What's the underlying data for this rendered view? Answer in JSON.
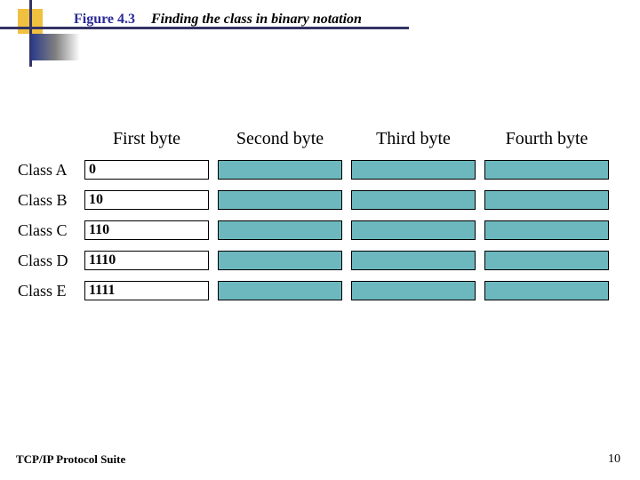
{
  "header": {
    "figure_label": "Figure 4.3",
    "figure_title": "Finding the class in binary notation"
  },
  "column_headers": [
    "First byte",
    "Second byte",
    "Third byte",
    "Fourth byte"
  ],
  "rows": [
    {
      "label": "Class A",
      "prefix": "0"
    },
    {
      "label": "Class B",
      "prefix": "10"
    },
    {
      "label": "Class C",
      "prefix": "110"
    },
    {
      "label": "Class D",
      "prefix": "1110"
    },
    {
      "label": "Class E",
      "prefix": "1111"
    }
  ],
  "footer": {
    "left": "TCP/IP Protocol Suite",
    "page": "10"
  }
}
